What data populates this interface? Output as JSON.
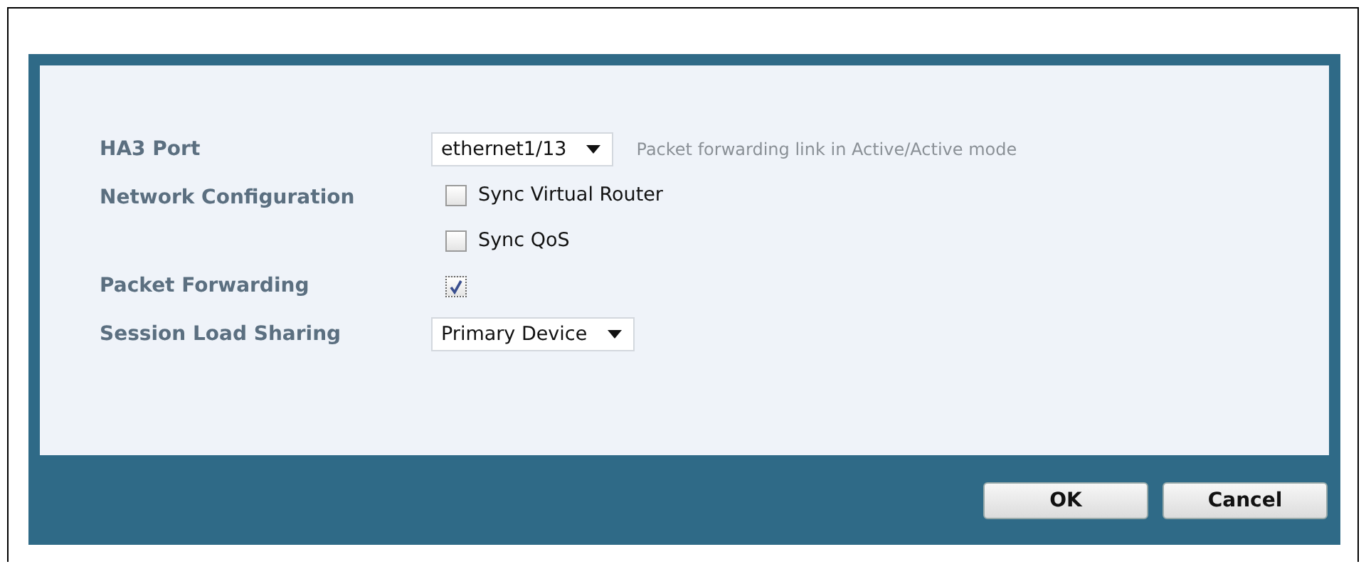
{
  "form": {
    "rows": [
      {
        "kind": "select",
        "label": "HA3 Port",
        "value": "ethernet1/13",
        "help": "Packet forwarding link in Active/Active mode"
      },
      {
        "kind": "checkboxes",
        "label": "Network Configuration",
        "options": [
          {
            "label": "Sync Virtual Router",
            "checked": false
          },
          {
            "label": "Sync QoS",
            "checked": false
          }
        ]
      },
      {
        "kind": "checkbox",
        "label": "Packet Forwarding",
        "checked": true
      },
      {
        "kind": "select",
        "label": "Session Load Sharing",
        "value": "Primary Device"
      }
    ]
  },
  "buttons": [
    "OK",
    "Cancel"
  ]
}
